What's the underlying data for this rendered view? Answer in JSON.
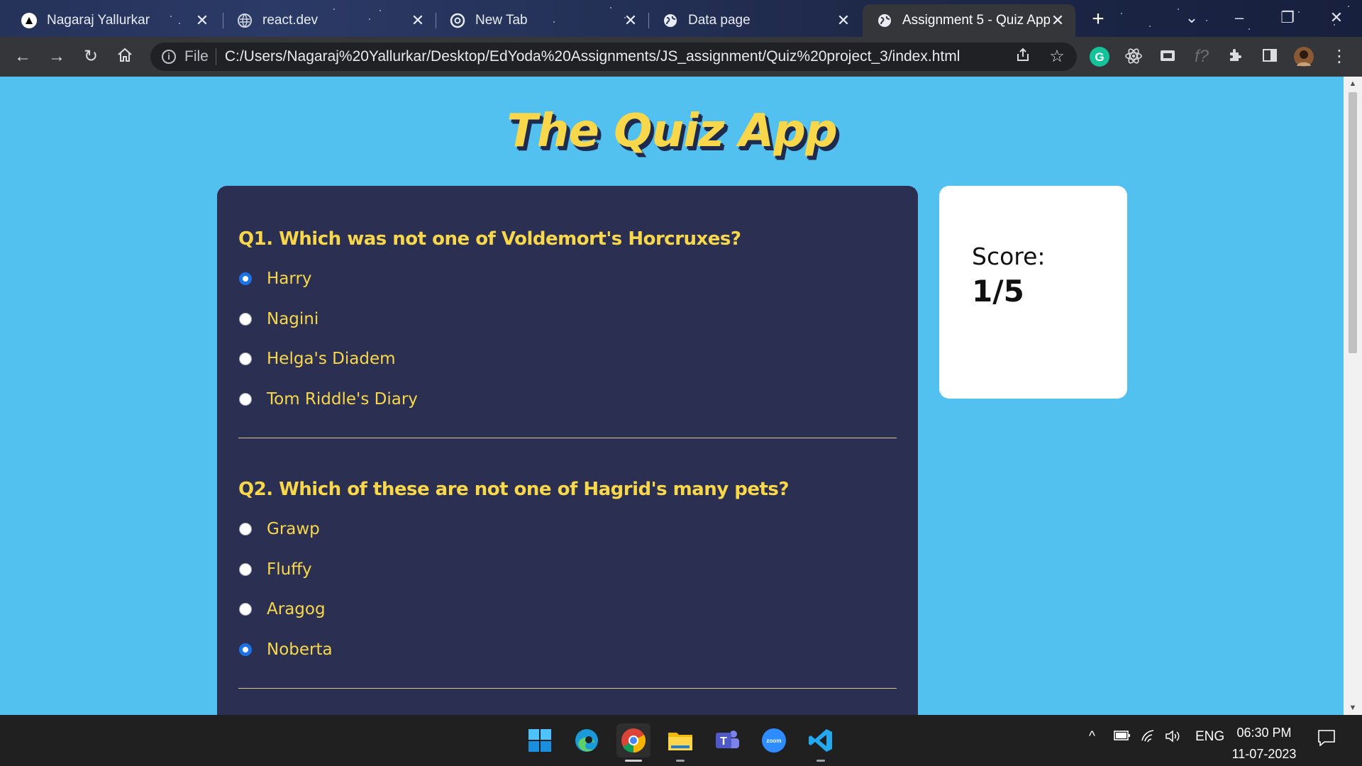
{
  "browser": {
    "tabs": [
      {
        "label": "Nagaraj Yallurkar",
        "icon": "vercel-triangle-icon",
        "active": false
      },
      {
        "label": "react.dev",
        "icon": "globe-icon",
        "active": false
      },
      {
        "label": "New Tab",
        "icon": "chrome-icon",
        "active": false
      },
      {
        "label": "Data page",
        "icon": "globe-icon",
        "active": false
      },
      {
        "label": "Assignment 5 - Quiz App",
        "icon": "globe-icon",
        "active": true
      }
    ],
    "address": {
      "scheme_label": "File",
      "url": "C:/Users/Nagaraj%20Yallurkar/Desktop/EdYoda%20Assignments/JS_assignment/Quiz%20project_3/index.html"
    }
  },
  "page": {
    "title": "The Quiz App",
    "questions": [
      {
        "title": "Q1. Which was not one of Voldemort's Horcruxes?",
        "options": [
          {
            "label": "Harry",
            "checked": true
          },
          {
            "label": "Nagini",
            "checked": false
          },
          {
            "label": "Helga's Diadem",
            "checked": false
          },
          {
            "label": "Tom Riddle's Diary",
            "checked": false
          }
        ]
      },
      {
        "title": "Q2. Which of these are not one of Hagrid's many pets?",
        "options": [
          {
            "label": "Grawp",
            "checked": false
          },
          {
            "label": "Fluffy",
            "checked": false
          },
          {
            "label": "Aragog",
            "checked": false
          },
          {
            "label": "Noberta",
            "checked": true
          }
        ]
      }
    ],
    "score": {
      "label": "Score:",
      "value": "1/5"
    }
  },
  "taskbar": {
    "apps": [
      "windows-start-icon",
      "edge-icon",
      "chrome-icon",
      "file-explorer-icon",
      "teams-icon",
      "zoom-icon",
      "vscode-icon"
    ],
    "zoom_label": "zoom",
    "language": "ENG",
    "time": "06:30 PM",
    "date": "11-07-2023"
  },
  "colors": {
    "page_bg": "#53c1ef",
    "card_bg": "#2b3052",
    "accent_yellow": "#f8d84a",
    "radio_checked": "#1a73e8"
  }
}
